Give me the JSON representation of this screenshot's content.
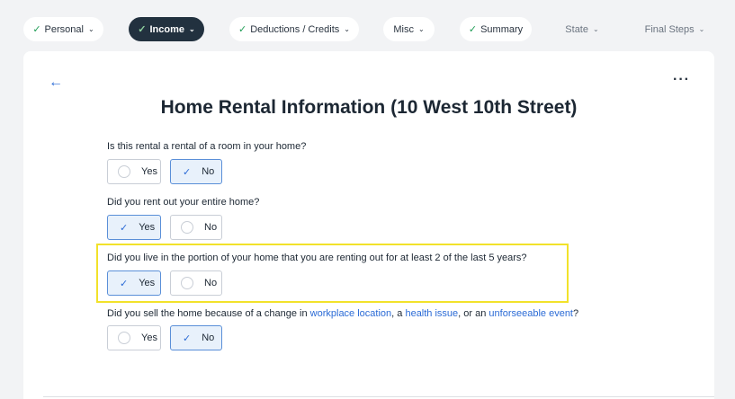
{
  "nav": [
    {
      "label": "Personal",
      "check": true,
      "active": false
    },
    {
      "label": "Income",
      "check": true,
      "active": true
    },
    {
      "label": "Deductions / Credits",
      "check": true,
      "active": false
    },
    {
      "label": "Misc",
      "check": false,
      "active": false
    },
    {
      "label": "Summary",
      "check": true,
      "active": false
    },
    {
      "label": "State",
      "check": false,
      "active": false
    },
    {
      "label": "Final Steps",
      "check": false,
      "active": false
    }
  ],
  "page": {
    "title": "Home Rental Information (10 West 10th Street)",
    "back_icon": "arrow-left-icon",
    "more_icon": "more-options-icon"
  },
  "questions": [
    {
      "text": "Is this rental a rental of a room in your home?",
      "yes": "Yes",
      "no": "No",
      "selected": "No"
    },
    {
      "text": "Did you rent out your entire home?",
      "yes": "Yes",
      "no": "No",
      "selected": "Yes"
    },
    {
      "text": "Did you live in the portion of your home that you are renting out for at least 2 of the last 5 years?",
      "yes": "Yes",
      "no": "No",
      "selected": "Yes"
    },
    {
      "text_parts": {
        "a": "Did you sell the home because of a change in ",
        "link1": "workplace location",
        "b": ", a ",
        "link2": "health issue",
        "c": ", or an ",
        "link3": "unforseeable event",
        "d": "?"
      },
      "yes": "Yes",
      "no": "No",
      "selected": "No"
    }
  ],
  "colors": {
    "accent": "#2b6bd6",
    "highlight": "#f2e22a",
    "active_pill": "#22313f",
    "check_green": "#1f9d55"
  }
}
